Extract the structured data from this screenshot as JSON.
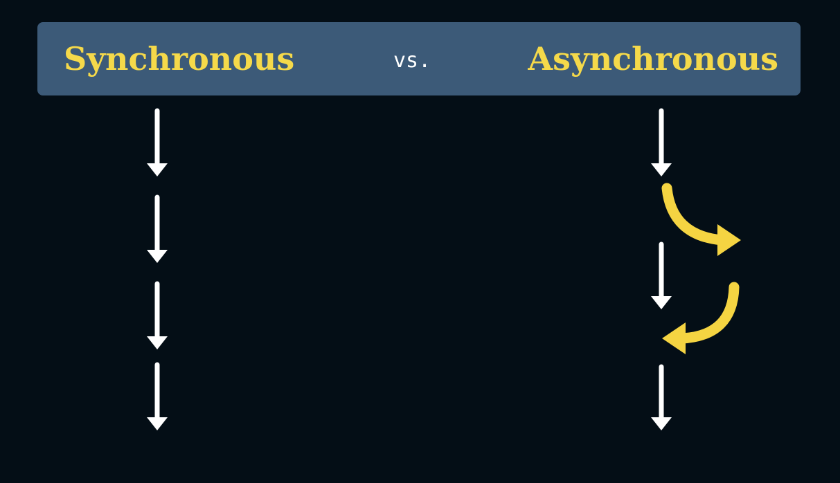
{
  "header": {
    "left_title": "Synchronous",
    "separator": "vs.",
    "right_title": "Asynchronous"
  },
  "colors": {
    "background": "#040e16",
    "header_bar": "#3c5a78",
    "title_text": "#f5d94a",
    "separator_text": "#ffffff",
    "flow_arrow": "#ffffff",
    "async_arrow": "#f5d442"
  },
  "diagram": {
    "synchronous_steps": 4,
    "asynchronous_steps": 4,
    "asynchronous_detours": 2
  }
}
